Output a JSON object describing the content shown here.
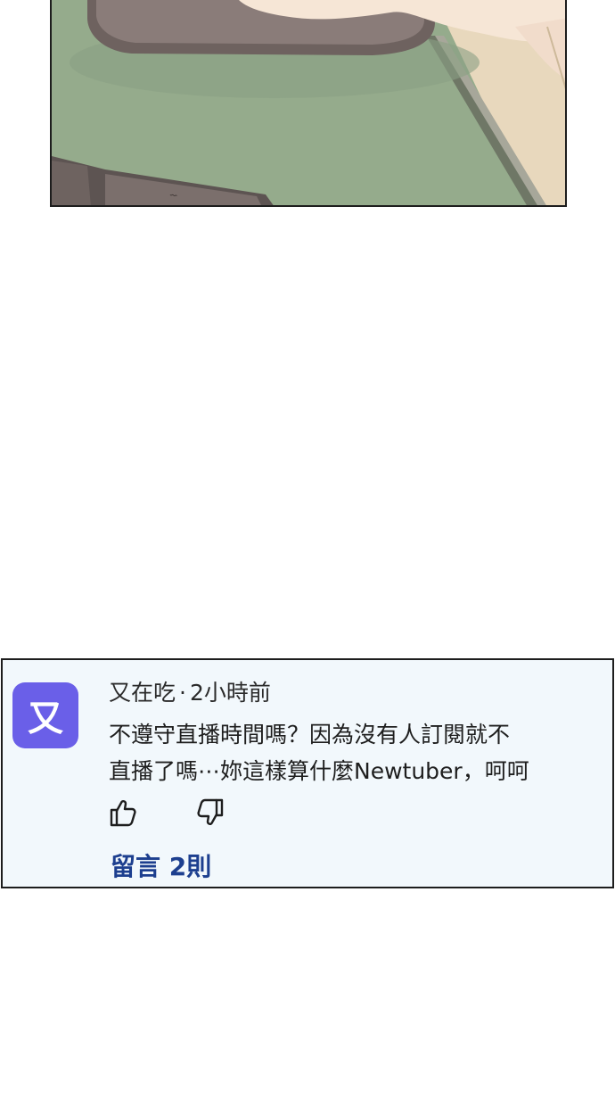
{
  "comment": {
    "avatar_letter": "又",
    "username": "又在吃",
    "separator": "·",
    "time": "2小時前",
    "lines": [
      "不遵守直播時間嗎？因為沒有人訂閱就不",
      "直播了嗎⋯妳這樣算什麼Newtuber，呵呵"
    ],
    "replies_label": "留言 2則",
    "like_icon": "thumbs-up-icon",
    "dislike_icon": "thumbs-down-icon"
  },
  "colors": {
    "avatar_bg": "#6a5fe8",
    "card_bg": "#f2f8fc",
    "link": "#1d3f8f",
    "mat_green": "#95ab8c"
  }
}
